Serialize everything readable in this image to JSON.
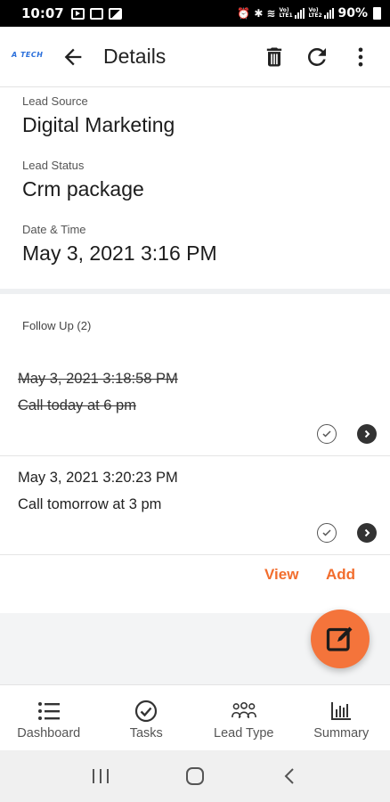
{
  "status_bar": {
    "time": "10:07",
    "battery": "90%",
    "network_label_1": "Vo) LTE1",
    "network_label_2": "Vo) LTE2"
  },
  "app_bar": {
    "logo_text": "A TECH",
    "title": "Details",
    "actions": [
      "delete-icon",
      "refresh-icon",
      "more-vert-icon"
    ]
  },
  "details": {
    "lead_source_label": "Lead Source",
    "lead_source_value": "Digital Marketing",
    "lead_status_label": "Lead Status",
    "lead_status_value": "Crm package",
    "date_time_label": "Date & Time",
    "date_time_value": "May 3, 2021 3:16 PM"
  },
  "follow_up": {
    "title": "Follow Up (2)",
    "items": [
      {
        "date": "May 3, 2021 3:18:58 PM",
        "note": "Call today at 6 pm",
        "completed": true
      },
      {
        "date": "May 3, 2021 3:20:23 PM",
        "note": "Call tomorrow at 3 pm",
        "completed": false
      }
    ],
    "view_label": "View",
    "add_label": "Add"
  },
  "bottom_nav": [
    {
      "label": "Dashboard",
      "icon": "list-icon"
    },
    {
      "label": "Tasks",
      "icon": "check-circle-icon"
    },
    {
      "label": "Lead Type",
      "icon": "group-icon"
    },
    {
      "label": "Summary",
      "icon": "bar-chart-icon"
    }
  ],
  "colors": {
    "accent": "#f26d2d",
    "fab": "#f4743b",
    "logo": "#2a6fdb"
  }
}
